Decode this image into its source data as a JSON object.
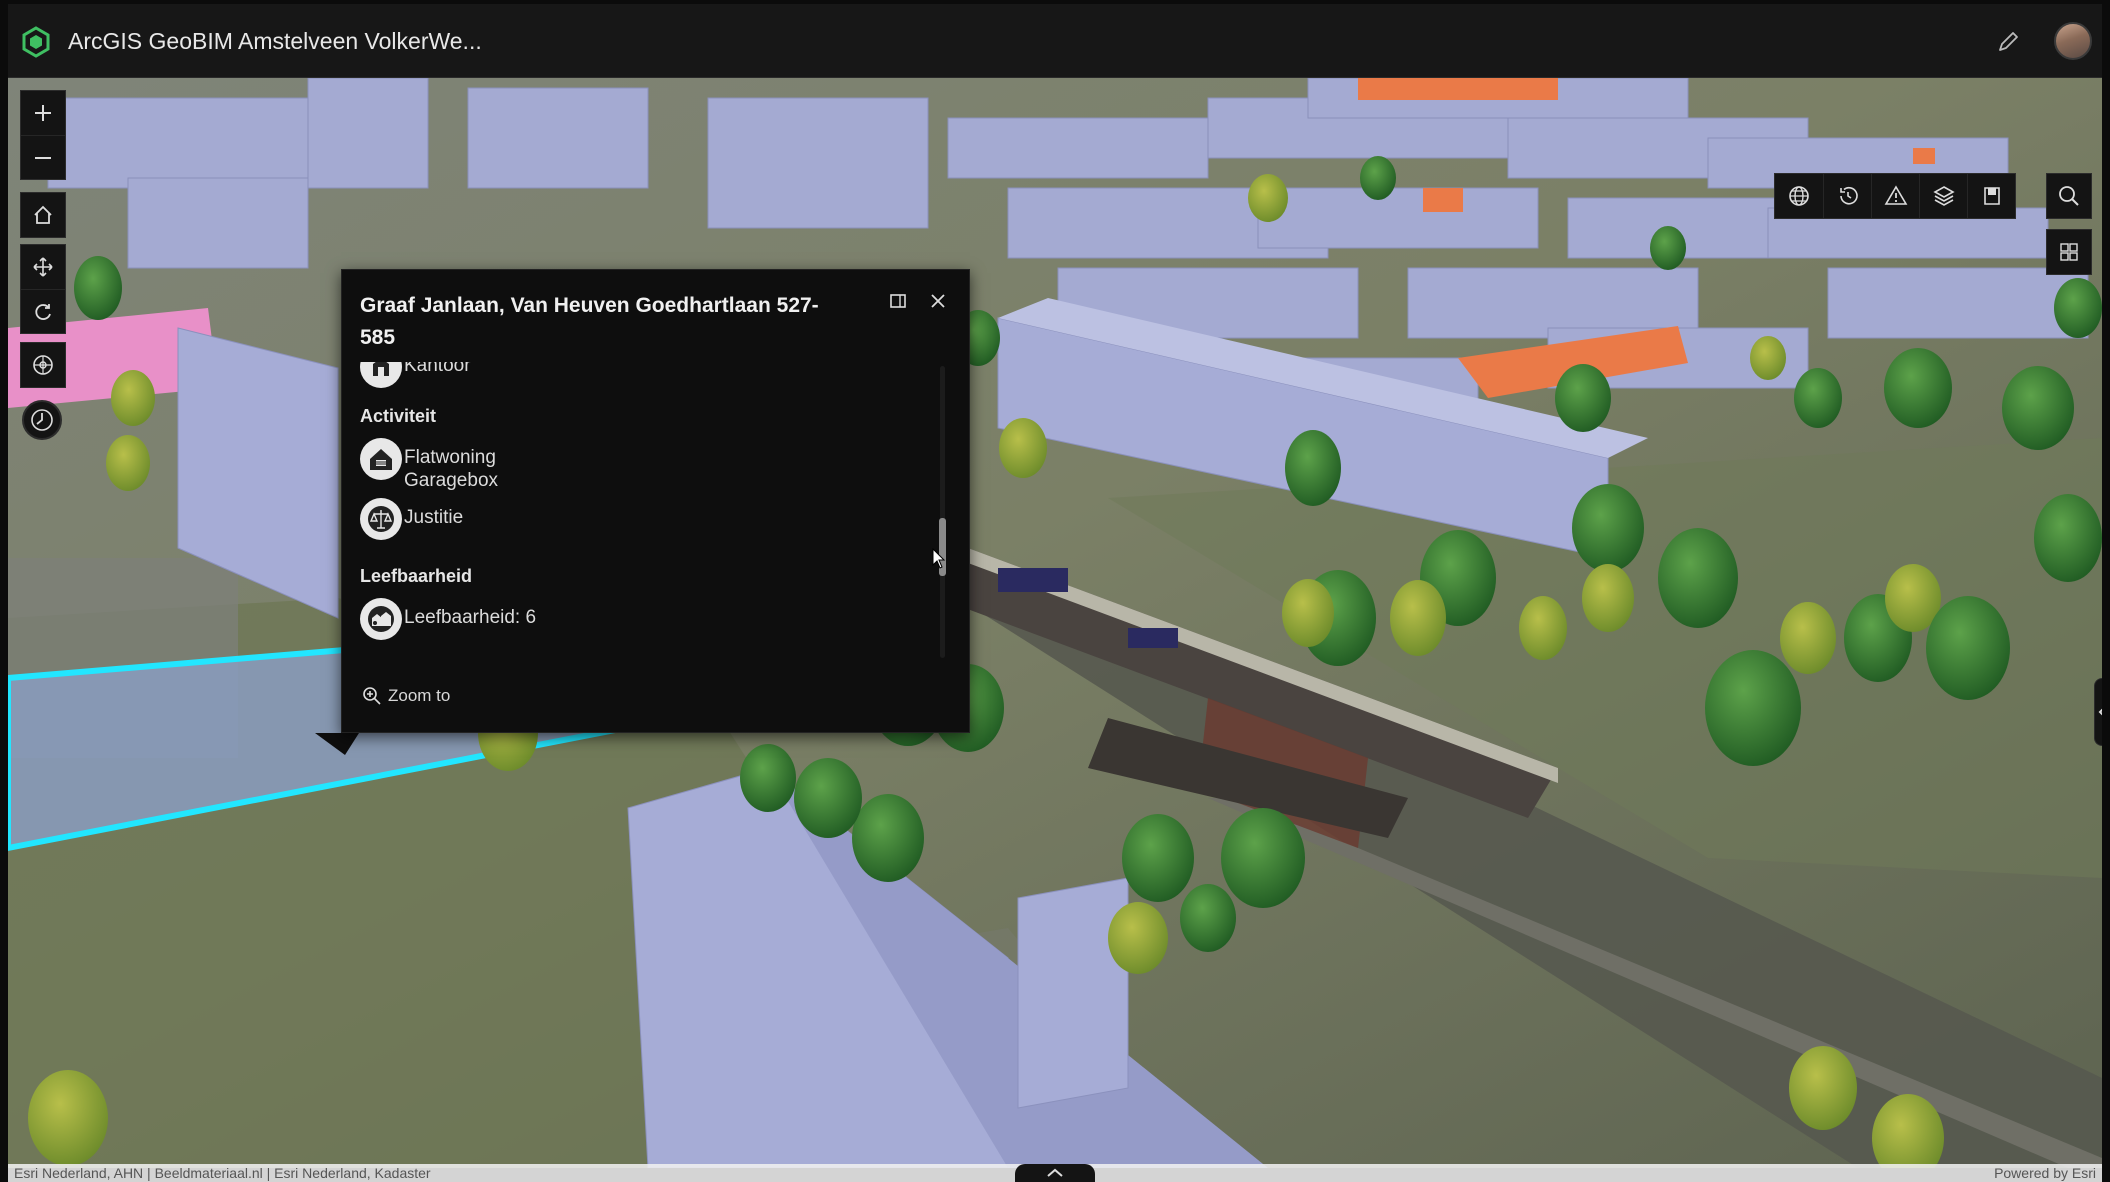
{
  "header": {
    "title": "ArcGIS GeoBIM Amstelveen VolkerWe...",
    "brand_color": "#3fbf62"
  },
  "popup": {
    "title": "Graaf Janlaan, Van Heuven Goedhartlaan 527-585",
    "sections": {
      "partial_item": {
        "label": "Kantoor"
      },
      "activiteit": {
        "heading": "Activiteit",
        "items": [
          {
            "label": "Flatwoning\nGaragebox",
            "icon": "home-garage-icon"
          },
          {
            "label": "Justitie",
            "icon": "scales-icon"
          }
        ]
      },
      "leefbaarheid": {
        "heading": "Leefbaarheid",
        "items": [
          {
            "label": "Leefbaarheid: 6",
            "icon": "neighborhood-icon"
          }
        ]
      }
    },
    "zoom_to_label": "Zoom to"
  },
  "map_controls": {
    "left": [
      "zoom-in-icon",
      "zoom-out-icon",
      "home-icon",
      "pan-icon",
      "rotate-icon",
      "compass-icon",
      "daylight-icon"
    ],
    "right": [
      "globe-icon",
      "history-icon",
      "warning-triangle-icon",
      "layers-icon",
      "bookmark-icon",
      "search-icon",
      "basemap-gallery-icon",
      "fullscreen-icon"
    ]
  },
  "attribution": {
    "text": "Esri Nederland, AHN | Beeldmateriaal.nl | Esri Nederland, Kadaster",
    "powered_by": "Powered by Esri"
  },
  "colors": {
    "selection_outline": "#22e6ff",
    "building_fill": "#a6acd6",
    "highlight_building": "#ee7a4a",
    "pink_building": "#e890c8"
  }
}
